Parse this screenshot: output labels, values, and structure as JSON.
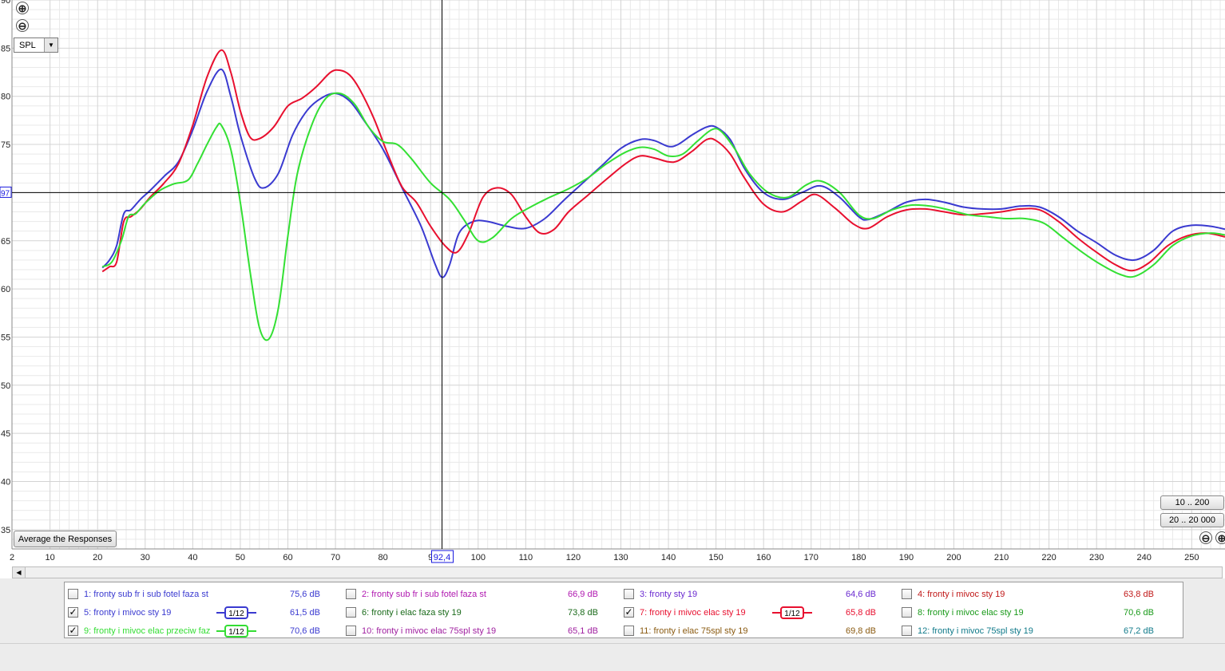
{
  "controls": {
    "zoom_in": "⊕",
    "zoom_out": "⊖",
    "spl_select": "SPL",
    "average_button": "Average the Responses",
    "range_10_200": "10 .. 200",
    "range_20_20000": "20 .. 20 000",
    "cursor_x_readout": "92,4",
    "cursor_y_readout": "97"
  },
  "colors": {
    "blue": "#3a3ad0",
    "red": "#e8102f",
    "green": "#33e033",
    "grid": "#d4d4d4",
    "grid_minor": "#e9e9e9"
  },
  "chart_data": {
    "type": "line",
    "xlim": [
      2,
      257
    ],
    "ylim": [
      33,
      90
    ],
    "cursor": {
      "x": 92.4,
      "y": 70
    },
    "x_ticks": [
      2,
      10,
      20,
      30,
      40,
      50,
      60,
      70,
      80,
      90,
      100,
      110,
      120,
      130,
      140,
      150,
      160,
      170,
      180,
      190,
      200,
      210,
      220,
      230,
      240,
      250
    ],
    "x_tick_labels": [
      "2",
      "10",
      "20",
      "30",
      "40",
      "50",
      "60",
      "70",
      "80",
      "9",
      "100",
      "110",
      "120",
      "130",
      "140",
      "150",
      "160",
      "170",
      "180",
      "190",
      "200",
      "210",
      "220",
      "230",
      "240",
      "250"
    ],
    "y_ticks": [
      35,
      40,
      45,
      50,
      55,
      60,
      65,
      70,
      75,
      80,
      85,
      90
    ],
    "y_tick_labels": [
      "35",
      "40",
      "45",
      "50",
      "55",
      "60",
      "65",
      "70",
      "75",
      "80",
      "85",
      "90"
    ],
    "grid": true,
    "series": [
      {
        "name": "5: fronty i mivoc sty 19",
        "color": "#3a3ad0",
        "points": [
          [
            21,
            62.2
          ],
          [
            22.5,
            63
          ],
          [
            24,
            64.5
          ],
          [
            25.5,
            67.8
          ],
          [
            27,
            68.2
          ],
          [
            29,
            69.3
          ],
          [
            31,
            70.2
          ],
          [
            34,
            71.7
          ],
          [
            37,
            73.2
          ],
          [
            40,
            76.5
          ],
          [
            43,
            80.5
          ],
          [
            46,
            82.8
          ],
          [
            48,
            80
          ],
          [
            50,
            76
          ],
          [
            53,
            71.5
          ],
          [
            55,
            70.5
          ],
          [
            58,
            72
          ],
          [
            61,
            76
          ],
          [
            64,
            78.5
          ],
          [
            67,
            79.8
          ],
          [
            70,
            80.3
          ],
          [
            73,
            79.5
          ],
          [
            76,
            77.5
          ],
          [
            80,
            74.5
          ],
          [
            84,
            70.5
          ],
          [
            88,
            66.5
          ],
          [
            91,
            62.5
          ],
          [
            92.5,
            61.2
          ],
          [
            94,
            62.5
          ],
          [
            96,
            65.8
          ],
          [
            99,
            67
          ],
          [
            102,
            67
          ],
          [
            106,
            66.5
          ],
          [
            110,
            66.3
          ],
          [
            114,
            67.3
          ],
          [
            118,
            69.2
          ],
          [
            122,
            71
          ],
          [
            126,
            72.8
          ],
          [
            130,
            74.6
          ],
          [
            134,
            75.5
          ],
          [
            137,
            75.4
          ],
          [
            140,
            74.8
          ],
          [
            142,
            75
          ],
          [
            145,
            76
          ],
          [
            148,
            76.8
          ],
          [
            150,
            76.8
          ],
          [
            153,
            75.5
          ],
          [
            156,
            72.5
          ],
          [
            160,
            70
          ],
          [
            164,
            69.3
          ],
          [
            168,
            70
          ],
          [
            172,
            70.7
          ],
          [
            176,
            69.5
          ],
          [
            180,
            67.5
          ],
          [
            182,
            67.2
          ],
          [
            186,
            68
          ],
          [
            190,
            69
          ],
          [
            194,
            69.3
          ],
          [
            198,
            69
          ],
          [
            202,
            68.5
          ],
          [
            206,
            68.3
          ],
          [
            210,
            68.3
          ],
          [
            214,
            68.6
          ],
          [
            218,
            68.5
          ],
          [
            222,
            67.5
          ],
          [
            226,
            66
          ],
          [
            230,
            64.8
          ],
          [
            234,
            63.5
          ],
          [
            238,
            63
          ],
          [
            242,
            64
          ],
          [
            246,
            66
          ],
          [
            250,
            66.6
          ],
          [
            254,
            66.5
          ],
          [
            257,
            66.2
          ]
        ]
      },
      {
        "name": "7: fronty i mivoc elac sty 19",
        "color": "#e8102f",
        "points": [
          [
            21,
            61.8
          ],
          [
            22.5,
            62.3
          ],
          [
            24,
            62.8
          ],
          [
            25.5,
            67
          ],
          [
            27,
            67.5
          ],
          [
            29,
            68.3
          ],
          [
            31,
            69.5
          ],
          [
            34,
            71
          ],
          [
            37,
            73
          ],
          [
            40,
            77
          ],
          [
            43,
            82
          ],
          [
            46,
            84.8
          ],
          [
            48,
            82.5
          ],
          [
            50,
            78.5
          ],
          [
            52,
            75.8
          ],
          [
            54,
            75.6
          ],
          [
            57,
            76.8
          ],
          [
            60,
            79
          ],
          [
            63,
            79.8
          ],
          [
            66,
            81
          ],
          [
            69,
            82.5
          ],
          [
            71,
            82.7
          ],
          [
            73,
            82.2
          ],
          [
            75,
            80.8
          ],
          [
            78,
            77.8
          ],
          [
            81,
            74
          ],
          [
            84,
            70.6
          ],
          [
            87,
            69
          ],
          [
            90,
            66.5
          ],
          [
            93,
            64.5
          ],
          [
            95.5,
            63.8
          ],
          [
            98,
            65.8
          ],
          [
            101,
            69.5
          ],
          [
            104,
            70.5
          ],
          [
            107,
            69.8
          ],
          [
            110,
            67.5
          ],
          [
            113,
            65.8
          ],
          [
            116,
            66.2
          ],
          [
            119,
            68
          ],
          [
            123,
            69.7
          ],
          [
            127,
            71.4
          ],
          [
            131,
            73
          ],
          [
            134,
            73.8
          ],
          [
            137,
            73.6
          ],
          [
            140,
            73.2
          ],
          [
            142,
            73.3
          ],
          [
            145,
            74.3
          ],
          [
            148,
            75.5
          ],
          [
            150,
            75.4
          ],
          [
            153,
            74
          ],
          [
            156,
            71.5
          ],
          [
            160,
            68.8
          ],
          [
            164,
            68
          ],
          [
            168,
            69.1
          ],
          [
            171,
            69.8
          ],
          [
            175,
            68.4
          ],
          [
            179,
            66.7
          ],
          [
            182,
            66.3
          ],
          [
            186,
            67.5
          ],
          [
            190,
            68.2
          ],
          [
            194,
            68.3
          ],
          [
            198,
            68
          ],
          [
            202,
            67.7
          ],
          [
            206,
            67.8
          ],
          [
            210,
            68
          ],
          [
            214,
            68.3
          ],
          [
            218,
            68.2
          ],
          [
            222,
            67
          ],
          [
            226,
            65.3
          ],
          [
            230,
            63.8
          ],
          [
            234,
            62.5
          ],
          [
            237.5,
            61.9
          ],
          [
            241,
            62.7
          ],
          [
            245,
            64.5
          ],
          [
            249,
            65.5
          ],
          [
            253,
            65.8
          ],
          [
            257,
            65.4
          ]
        ]
      },
      {
        "name": "9: fronty i mivoc elac przeciw faz",
        "color": "#33e033",
        "points": [
          [
            21,
            62.3
          ],
          [
            23,
            62.8
          ],
          [
            25,
            65
          ],
          [
            26.5,
            67.5
          ],
          [
            28,
            67.8
          ],
          [
            30,
            68.9
          ],
          [
            33,
            70.2
          ],
          [
            36,
            70.9
          ],
          [
            39,
            71.3
          ],
          [
            41,
            73
          ],
          [
            43,
            75
          ],
          [
            45,
            76.8
          ],
          [
            46,
            77
          ],
          [
            48,
            74.5
          ],
          [
            50,
            69
          ],
          [
            52,
            62
          ],
          [
            54,
            56
          ],
          [
            56,
            54.8
          ],
          [
            58,
            58
          ],
          [
            60,
            65.5
          ],
          [
            62,
            72
          ],
          [
            65,
            77
          ],
          [
            68,
            79.8
          ],
          [
            71,
            80.3
          ],
          [
            74,
            79.2
          ],
          [
            77,
            76.8
          ],
          [
            80,
            75.3
          ],
          [
            83,
            75
          ],
          [
            86,
            73.5
          ],
          [
            90,
            71
          ],
          [
            94,
            69.3
          ],
          [
            97,
            67.2
          ],
          [
            100,
            65
          ],
          [
            103,
            65.3
          ],
          [
            107,
            67.3
          ],
          [
            111,
            68.5
          ],
          [
            115,
            69.5
          ],
          [
            119,
            70.4
          ],
          [
            123,
            71.5
          ],
          [
            127,
            73
          ],
          [
            131,
            74.2
          ],
          [
            134,
            74.7
          ],
          [
            137,
            74.5
          ],
          [
            140,
            73.8
          ],
          [
            143,
            74
          ],
          [
            146,
            75.3
          ],
          [
            149,
            76.5
          ],
          [
            151,
            76.4
          ],
          [
            154,
            74.5
          ],
          [
            157,
            72
          ],
          [
            161,
            70
          ],
          [
            165,
            69.5
          ],
          [
            169,
            70.8
          ],
          [
            172,
            71.2
          ],
          [
            176,
            70
          ],
          [
            180,
            67.7
          ],
          [
            183,
            67.3
          ],
          [
            187,
            68.2
          ],
          [
            191,
            68.7
          ],
          [
            195,
            68.6
          ],
          [
            199,
            68.2
          ],
          [
            203,
            67.7
          ],
          [
            207,
            67.5
          ],
          [
            211,
            67.3
          ],
          [
            215,
            67.3
          ],
          [
            219,
            66.8
          ],
          [
            223,
            65.3
          ],
          [
            227,
            63.8
          ],
          [
            231,
            62.5
          ],
          [
            235,
            61.5
          ],
          [
            238,
            61.3
          ],
          [
            242,
            62.5
          ],
          [
            246,
            64.5
          ],
          [
            250,
            65.5
          ],
          [
            254,
            65.8
          ],
          [
            257,
            65.6
          ]
        ]
      }
    ]
  },
  "legend": [
    {
      "id": 1,
      "label": "1: fronty sub fr i sub fotel faza st",
      "value": "75,6 dB",
      "checked": false,
      "color": "#3a3ad0",
      "value_color": "#3a3ad0"
    },
    {
      "id": 2,
      "label": "2: fronty sub fr i sub fotel faza st",
      "value": "66,9 dB",
      "checked": false,
      "color": "#b018b0",
      "value_color": "#b018b0"
    },
    {
      "id": 3,
      "label": "3: fronty sty 19",
      "value": "64,6 dB",
      "checked": false,
      "color": "#6a2ad0",
      "value_color": "#6a2ad0"
    },
    {
      "id": 4,
      "label": "4: fronty i mivoc sty 19",
      "value": "63,8 dB",
      "checked": false,
      "color": "#c01818",
      "value_color": "#c01818"
    },
    {
      "id": 5,
      "label": "5: fronty i mivoc sty 19",
      "value": "61,5 dB",
      "checked": true,
      "color": "#3a3ad0",
      "value_color": "#3a3ad0",
      "smoothing": "1/12"
    },
    {
      "id": 6,
      "label": "6: fronty i elac faza sty 19",
      "value": "73,8 dB",
      "checked": false,
      "color": "#1a6a1a",
      "value_color": "#1a6a1a"
    },
    {
      "id": 7,
      "label": "7: fronty i mivoc elac sty 19",
      "value": "65,8 dB",
      "checked": true,
      "color": "#e8102f",
      "value_color": "#e8102f",
      "smoothing": "1/12"
    },
    {
      "id": 8,
      "label": "8: fronty i mivoc elac sty 19",
      "value": "70,6 dB",
      "checked": false,
      "color": "#1a9a1a",
      "value_color": "#1a9a1a"
    },
    {
      "id": 9,
      "label": "9: fronty i mivoc elac przeciw faz",
      "value": "70,6 dB",
      "checked": true,
      "color": "#33dd33",
      "value_color": "#3a3ad0",
      "smoothing": "1/12"
    },
    {
      "id": 10,
      "label": "10: fronty i mivoc elac 75spl sty 19",
      "value": "65,1 dB",
      "checked": false,
      "color": "#a020a0",
      "value_color": "#a020a0"
    },
    {
      "id": 11,
      "label": "11: fronty i  elac 75spl sty 19",
      "value": "69,8 dB",
      "checked": false,
      "color": "#8a5a10",
      "value_color": "#8a5a10"
    },
    {
      "id": 12,
      "label": "12: fronty i  mivoc 75spl sty 19",
      "value": "67,2 dB",
      "checked": false,
      "color": "#107a8a",
      "value_color": "#107a8a"
    }
  ]
}
